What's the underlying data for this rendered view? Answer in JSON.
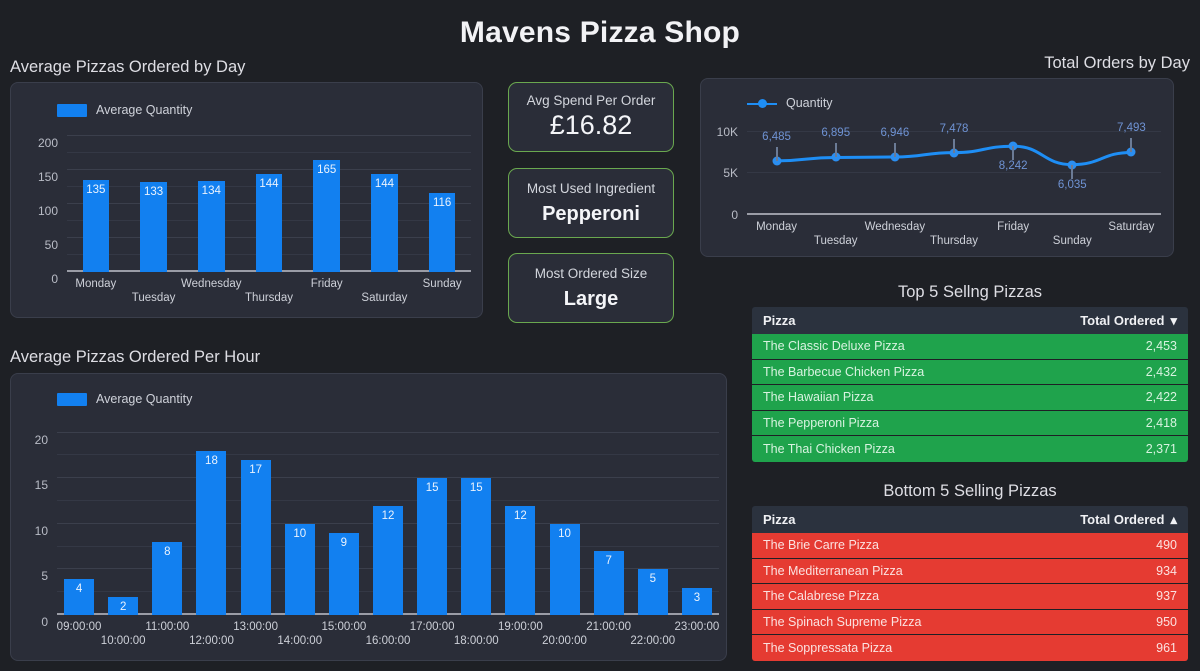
{
  "dashboard": {
    "title": "Mavens Pizza Shop"
  },
  "sections": {
    "avg_by_day_title": "Average Pizzas Ordered by Day",
    "avg_per_hour_title": "Average Pizzas Ordered Per Hour",
    "total_orders_title": "Total Orders by Day",
    "top5_title": "Top 5 Sellng Pizzas",
    "bottom5_title": "Bottom 5 Selling Pizzas"
  },
  "kpis": [
    {
      "label": "Avg Spend Per Order",
      "value": "£16.82",
      "bold": false
    },
    {
      "label": "Most Used Ingredient",
      "value": "Pepperoni",
      "bold": true
    },
    {
      "label": "Most Ordered Size",
      "value": "Large",
      "bold": true
    }
  ],
  "tables": {
    "top5": {
      "columns": [
        "Pizza",
        "Total Ordered"
      ],
      "sort": "desc",
      "sort_glyph": "▾",
      "rows": [
        {
          "pizza": "The Classic Deluxe Pizza",
          "total": "2,453"
        },
        {
          "pizza": "The Barbecue Chicken Pizza",
          "total": "2,432"
        },
        {
          "pizza": "The Hawaiian Pizza",
          "total": "2,422"
        },
        {
          "pizza": "The Pepperoni Pizza",
          "total": "2,418"
        },
        {
          "pizza": "The Thai Chicken Pizza",
          "total": "2,371"
        }
      ]
    },
    "bottom5": {
      "columns": [
        "Pizza",
        "Total Ordered"
      ],
      "sort": "asc",
      "sort_glyph": "▴",
      "rows": [
        {
          "pizza": "The Brie Carre Pizza",
          "total": "490"
        },
        {
          "pizza": "The Mediterranean Pizza",
          "total": "934"
        },
        {
          "pizza": "The Calabrese Pizza",
          "total": "937"
        },
        {
          "pizza": "The Spinach Supreme Pizza",
          "total": "950"
        },
        {
          "pizza": "The Soppressata Pizza",
          "total": "961"
        }
      ]
    }
  },
  "colors": {
    "page_bg": "#1e2025",
    "panel_bg": "#2a2d38",
    "bar_blue": "#1280f0",
    "line_blue": "#1e8ef5",
    "kpi_border": "#6aa84f",
    "table_green": "#1fa34c",
    "table_red": "#e53b32",
    "point_label": "#6f93d4"
  },
  "chart_data": [
    {
      "type": "bar",
      "title": "Average Pizzas Ordered by Day",
      "legend": [
        "Average Quantity"
      ],
      "legend_position": "top-left",
      "categories": [
        "Monday",
        "Tuesday",
        "Wednesday",
        "Thursday",
        "Friday",
        "Saturday",
        "Sunday"
      ],
      "values": [
        135,
        133,
        134,
        144,
        165,
        144,
        116
      ],
      "xlabel": "",
      "ylabel": "",
      "ylim": [
        0,
        215
      ],
      "yticks": [
        0,
        50,
        100,
        150,
        200
      ],
      "ytick_labels": [
        "0",
        "50",
        "100",
        "150",
        "200"
      ],
      "grid": true
    },
    {
      "type": "line",
      "title": "Total Orders by Day",
      "legend": [
        "Quantity"
      ],
      "legend_position": "top-left",
      "categories": [
        "Monday",
        "Tuesday",
        "Wednesday",
        "Thursday",
        "Friday",
        "Sunday",
        "Saturday"
      ],
      "values": [
        6485,
        6895,
        6946,
        7478,
        8242,
        6035,
        7493
      ],
      "value_labels": [
        "6,485",
        "6,895",
        "6,946",
        "7,478",
        "8,242",
        "6,035",
        "7,493"
      ],
      "xlabel": "",
      "ylabel": "",
      "ylim": [
        0,
        11500
      ],
      "yticks": [
        0,
        5000,
        10000
      ],
      "ytick_labels": [
        "0",
        "5K",
        "10K"
      ],
      "grid": true
    },
    {
      "type": "bar",
      "title": "Average Pizzas Ordered Per Hour",
      "legend": [
        "Average Quantity"
      ],
      "legend_position": "top-left",
      "categories": [
        "09:00:00",
        "10:00:00",
        "11:00:00",
        "12:00:00",
        "13:00:00",
        "14:00:00",
        "15:00:00",
        "16:00:00",
        "17:00:00",
        "18:00:00",
        "19:00:00",
        "20:00:00",
        "21:00:00",
        "22:00:00",
        "23:00:00"
      ],
      "values": [
        4,
        2,
        8,
        18,
        17,
        10,
        9,
        12,
        15,
        15,
        12,
        10,
        7,
        5,
        3
      ],
      "xlabel": "",
      "ylabel": "",
      "ylim": [
        0,
        21.5
      ],
      "yticks": [
        0,
        5,
        10,
        15,
        20
      ],
      "ytick_labels": [
        "0",
        "5",
        "10",
        "15",
        "20"
      ],
      "grid": true
    }
  ]
}
